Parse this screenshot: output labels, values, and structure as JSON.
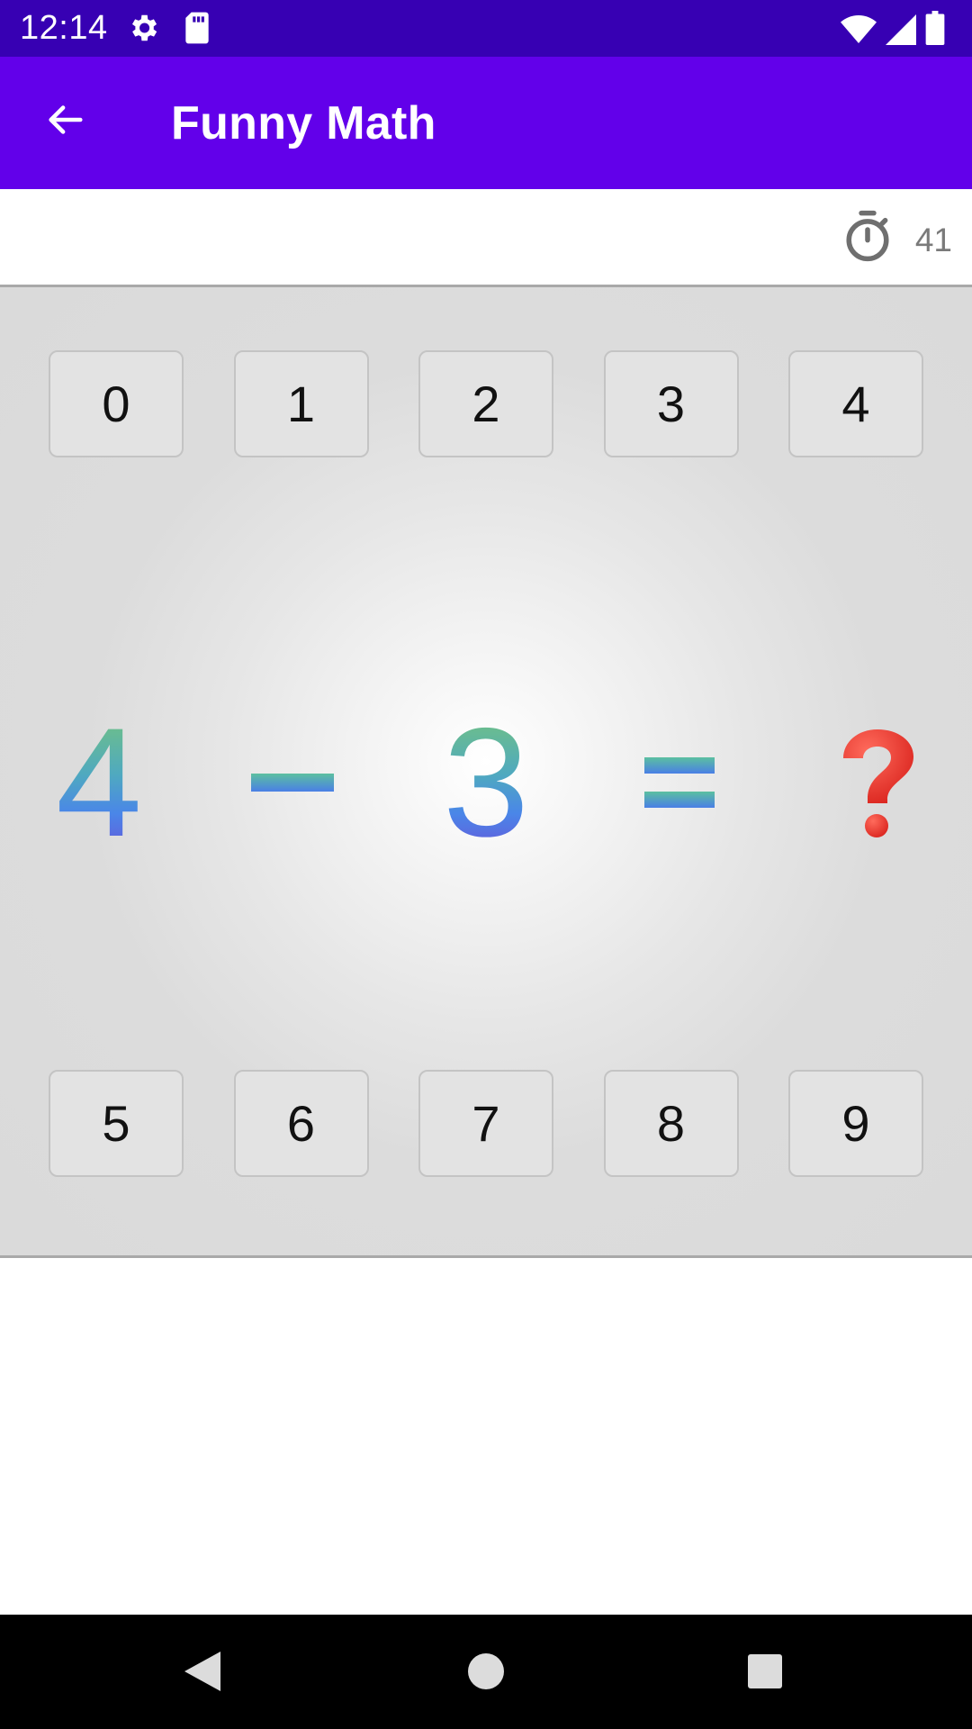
{
  "status_bar": {
    "time": "12:14",
    "icons": [
      "settings-icon",
      "sd-card-icon",
      "wifi-icon",
      "signal-icon",
      "battery-icon"
    ],
    "background": "#3700b3"
  },
  "app_bar": {
    "title": "Funny Math",
    "back_icon": "arrow-back-icon",
    "background": "#6200ea"
  },
  "timer": {
    "icon": "stopwatch-icon",
    "value": "41"
  },
  "keypad_top": [
    "0",
    "1",
    "2",
    "3",
    "4"
  ],
  "keypad_bottom": [
    "5",
    "6",
    "7",
    "8",
    "9"
  ],
  "equation": {
    "operand_a": "4",
    "operator": "minus",
    "operand_b": "3",
    "equals": "equals",
    "unknown": "question-mark"
  },
  "nav_bar": {
    "icons": [
      "back-triangle-icon",
      "home-circle-icon",
      "recents-square-icon"
    ]
  }
}
